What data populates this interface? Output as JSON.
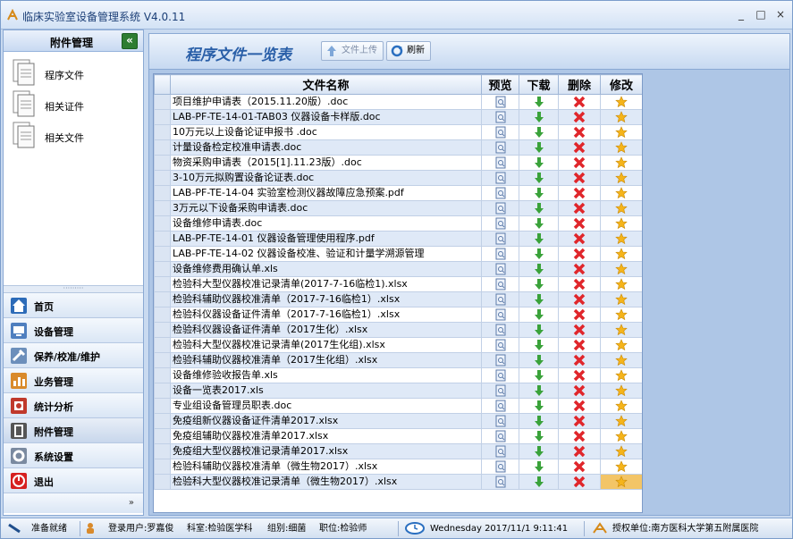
{
  "window": {
    "title": "临床实验室设备管理系统",
    "version": "V4.0.11",
    "controls": [
      "_",
      "□",
      "×"
    ]
  },
  "sidebar": {
    "header": "附件管理",
    "attachments": [
      {
        "label": "程序文件",
        "icon": "document-icon"
      },
      {
        "label": "相关证件",
        "icon": "document-icon"
      },
      {
        "label": "相关文件",
        "icon": "document-icon"
      }
    ],
    "nav": [
      {
        "label": "首页",
        "icon": "home-icon",
        "color": "#2c6bb8"
      },
      {
        "label": "设备管理",
        "icon": "device-icon",
        "color": "#4f7fbf"
      },
      {
        "label": "保养/校准/维护",
        "icon": "maintenance-icon",
        "color": "#6c8fbb"
      },
      {
        "label": "业务管理",
        "icon": "business-icon",
        "color": "#d98a2b"
      },
      {
        "label": "统计分析",
        "icon": "statistics-icon",
        "color": "#c0392b"
      },
      {
        "label": "附件管理",
        "icon": "attachment-icon",
        "color": "#555555"
      },
      {
        "label": "系统设置",
        "icon": "settings-icon",
        "color": "#7a8aa0"
      },
      {
        "label": "退出",
        "icon": "exit-icon",
        "color": "#d62020"
      }
    ]
  },
  "main": {
    "title": "程序文件一览表",
    "upload_label": "文件上传",
    "refresh_label": "刷新",
    "columns": [
      "文件名称",
      "预览",
      "下载",
      "删除",
      "修改"
    ],
    "files": [
      "项目维护申请表（2015.11.20版）.doc",
      "LAB-PF-TE-14-01-TAB03 仪器设备卡样版.doc",
      "10万元以上设备论证申报书 .doc",
      "计量设备检定校准申请表.doc",
      "物资采购申请表（2015[1].11.23版）.doc",
      "3-10万元拟购置设备论证表.doc",
      "LAB-PF-TE-14-04 实验室检测仪器故障应急预案.pdf",
      "3万元以下设备采购申请表.doc",
      "设备维修申请表.doc",
      "LAB-PF-TE-14-01 仪器设备管理使用程序.pdf",
      "LAB-PF-TE-14-02 仪器设备校准、验证和计量学溯源管理",
      "设备维修费用确认单.xls",
      "检验科大型仪器校准记录清单(2017-7-16临检1).xlsx",
      "检验科辅助仪器校准清单（2017-7-16临检1）.xlsx",
      "检验科仪器设备证件清单（2017-7-16临检1）.xlsx",
      "检验科仪器设备证件清单（2017生化）.xlsx",
      "检验科大型仪器校准记录清单(2017生化组).xlsx",
      "检验科辅助仪器校准清单（2017生化组）.xlsx",
      "设备维修验收报告单.xls",
      "设备一览表2017.xls",
      "专业组设备管理员职表.doc",
      "免疫组新仪器设备证件清单2017.xlsx",
      "免疫组辅助仪器校准清单2017.xlsx",
      "免疫组大型仪器校准记录清单2017.xlsx",
      "检验科辅助仪器校准清单（微生物2017）.xlsx",
      "检验科大型仪器校准记录清单（微生物2017）.xlsx"
    ]
  },
  "statusbar": {
    "ready": "准备就绪",
    "user": "登录用户:罗嘉俊",
    "dept": "科室:检验医学科",
    "group": "组别:细菌",
    "position": "职位:检验师",
    "datetime": "Wednesday 2017/11/1 9:11:41",
    "org": "授权单位:南方医科大学第五附属医院"
  }
}
